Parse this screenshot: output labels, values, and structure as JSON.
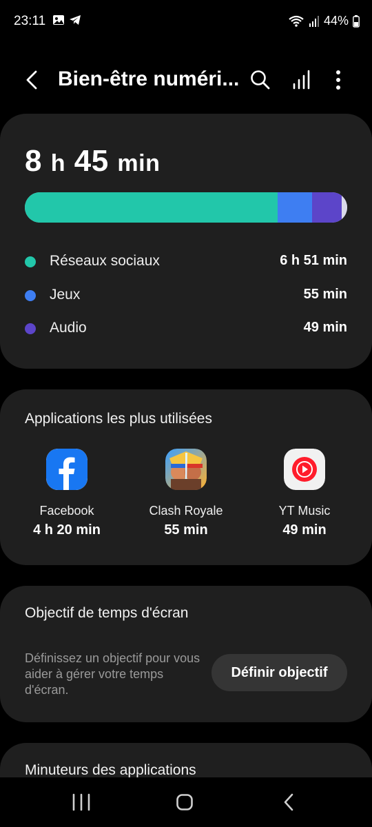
{
  "status": {
    "time": "23:11",
    "battery": "44%",
    "icons": [
      "image-icon",
      "telegram-icon",
      "wifi-icon",
      "signal-icon",
      "battery-icon"
    ]
  },
  "header": {
    "title": "Bien-être numéri..."
  },
  "usage": {
    "total_hours": "8",
    "total_h_unit": "h",
    "total_minutes": "45",
    "total_min_unit": "min",
    "bar_fractions": [
      0.785,
      0.105,
      0.093,
      0.017
    ],
    "bar_colors": [
      "#22c7aa",
      "#3e7ef2",
      "#5c45c9",
      "#d9d9ea"
    ],
    "categories": [
      {
        "name": "Réseaux sociaux",
        "time": "6 h 51 min",
        "color": "#22c7aa"
      },
      {
        "name": "Jeux",
        "time": "55 min",
        "color": "#3e7ef2"
      },
      {
        "name": "Audio",
        "time": "49 min",
        "color": "#5c45c9"
      }
    ]
  },
  "top_apps": {
    "heading": "Applications les plus utilisées",
    "apps": [
      {
        "name": "Facebook",
        "time": "4 h 20 min",
        "icon": "facebook-icon"
      },
      {
        "name": "Clash Royale",
        "time": "55 min",
        "icon": "clash-royale-icon"
      },
      {
        "name": "YT Music",
        "time": "49 min",
        "icon": "yt-music-icon"
      }
    ]
  },
  "goal": {
    "heading": "Objectif de temps d'écran",
    "description": "Définissez un objectif pour vous aider à gérer votre temps d'écran.",
    "button": "Définir objectif"
  },
  "timers": {
    "heading": "Minuteurs des applications"
  },
  "colors": {
    "background": "#000000",
    "card": "#1f1f1f",
    "social": "#22c7aa",
    "games": "#3e7ef2",
    "audio": "#5c45c9"
  }
}
